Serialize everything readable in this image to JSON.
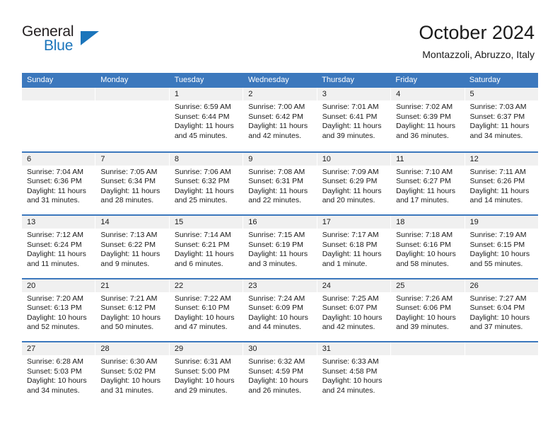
{
  "brand": {
    "name_part1": "General",
    "name_part2": "Blue",
    "logo_icon": "triangle-logo-icon"
  },
  "header": {
    "title": "October 2024",
    "subtitle": "Montazzoli, Abruzzo, Italy"
  },
  "colors": {
    "header_blue": "#3c78bd",
    "brand_blue": "#1b75bb",
    "daynum_bg": "#f0f0f0",
    "text": "#1a1a1a"
  },
  "weekdays": [
    "Sunday",
    "Monday",
    "Tuesday",
    "Wednesday",
    "Thursday",
    "Friday",
    "Saturday"
  ],
  "labels": {
    "sunrise_prefix": "Sunrise: ",
    "sunset_prefix": "Sunset: ",
    "daylight_prefix": "Daylight: "
  },
  "weeks": [
    [
      {
        "day": "",
        "empty": true
      },
      {
        "day": "",
        "empty": true
      },
      {
        "day": "1",
        "sunrise": "Sunrise: 6:59 AM",
        "sunset": "Sunset: 6:44 PM",
        "daylight": "Daylight: 11 hours and 45 minutes."
      },
      {
        "day": "2",
        "sunrise": "Sunrise: 7:00 AM",
        "sunset": "Sunset: 6:42 PM",
        "daylight": "Daylight: 11 hours and 42 minutes."
      },
      {
        "day": "3",
        "sunrise": "Sunrise: 7:01 AM",
        "sunset": "Sunset: 6:41 PM",
        "daylight": "Daylight: 11 hours and 39 minutes."
      },
      {
        "day": "4",
        "sunrise": "Sunrise: 7:02 AM",
        "sunset": "Sunset: 6:39 PM",
        "daylight": "Daylight: 11 hours and 36 minutes."
      },
      {
        "day": "5",
        "sunrise": "Sunrise: 7:03 AM",
        "sunset": "Sunset: 6:37 PM",
        "daylight": "Daylight: 11 hours and 34 minutes."
      }
    ],
    [
      {
        "day": "6",
        "sunrise": "Sunrise: 7:04 AM",
        "sunset": "Sunset: 6:36 PM",
        "daylight": "Daylight: 11 hours and 31 minutes."
      },
      {
        "day": "7",
        "sunrise": "Sunrise: 7:05 AM",
        "sunset": "Sunset: 6:34 PM",
        "daylight": "Daylight: 11 hours and 28 minutes."
      },
      {
        "day": "8",
        "sunrise": "Sunrise: 7:06 AM",
        "sunset": "Sunset: 6:32 PM",
        "daylight": "Daylight: 11 hours and 25 minutes."
      },
      {
        "day": "9",
        "sunrise": "Sunrise: 7:08 AM",
        "sunset": "Sunset: 6:31 PM",
        "daylight": "Daylight: 11 hours and 22 minutes."
      },
      {
        "day": "10",
        "sunrise": "Sunrise: 7:09 AM",
        "sunset": "Sunset: 6:29 PM",
        "daylight": "Daylight: 11 hours and 20 minutes."
      },
      {
        "day": "11",
        "sunrise": "Sunrise: 7:10 AM",
        "sunset": "Sunset: 6:27 PM",
        "daylight": "Daylight: 11 hours and 17 minutes."
      },
      {
        "day": "12",
        "sunrise": "Sunrise: 7:11 AM",
        "sunset": "Sunset: 6:26 PM",
        "daylight": "Daylight: 11 hours and 14 minutes."
      }
    ],
    [
      {
        "day": "13",
        "sunrise": "Sunrise: 7:12 AM",
        "sunset": "Sunset: 6:24 PM",
        "daylight": "Daylight: 11 hours and 11 minutes."
      },
      {
        "day": "14",
        "sunrise": "Sunrise: 7:13 AM",
        "sunset": "Sunset: 6:22 PM",
        "daylight": "Daylight: 11 hours and 9 minutes."
      },
      {
        "day": "15",
        "sunrise": "Sunrise: 7:14 AM",
        "sunset": "Sunset: 6:21 PM",
        "daylight": "Daylight: 11 hours and 6 minutes."
      },
      {
        "day": "16",
        "sunrise": "Sunrise: 7:15 AM",
        "sunset": "Sunset: 6:19 PM",
        "daylight": "Daylight: 11 hours and 3 minutes."
      },
      {
        "day": "17",
        "sunrise": "Sunrise: 7:17 AM",
        "sunset": "Sunset: 6:18 PM",
        "daylight": "Daylight: 11 hours and 1 minute."
      },
      {
        "day": "18",
        "sunrise": "Sunrise: 7:18 AM",
        "sunset": "Sunset: 6:16 PM",
        "daylight": "Daylight: 10 hours and 58 minutes."
      },
      {
        "day": "19",
        "sunrise": "Sunrise: 7:19 AM",
        "sunset": "Sunset: 6:15 PM",
        "daylight": "Daylight: 10 hours and 55 minutes."
      }
    ],
    [
      {
        "day": "20",
        "sunrise": "Sunrise: 7:20 AM",
        "sunset": "Sunset: 6:13 PM",
        "daylight": "Daylight: 10 hours and 52 minutes."
      },
      {
        "day": "21",
        "sunrise": "Sunrise: 7:21 AM",
        "sunset": "Sunset: 6:12 PM",
        "daylight": "Daylight: 10 hours and 50 minutes."
      },
      {
        "day": "22",
        "sunrise": "Sunrise: 7:22 AM",
        "sunset": "Sunset: 6:10 PM",
        "daylight": "Daylight: 10 hours and 47 minutes."
      },
      {
        "day": "23",
        "sunrise": "Sunrise: 7:24 AM",
        "sunset": "Sunset: 6:09 PM",
        "daylight": "Daylight: 10 hours and 44 minutes."
      },
      {
        "day": "24",
        "sunrise": "Sunrise: 7:25 AM",
        "sunset": "Sunset: 6:07 PM",
        "daylight": "Daylight: 10 hours and 42 minutes."
      },
      {
        "day": "25",
        "sunrise": "Sunrise: 7:26 AM",
        "sunset": "Sunset: 6:06 PM",
        "daylight": "Daylight: 10 hours and 39 minutes."
      },
      {
        "day": "26",
        "sunrise": "Sunrise: 7:27 AM",
        "sunset": "Sunset: 6:04 PM",
        "daylight": "Daylight: 10 hours and 37 minutes."
      }
    ],
    [
      {
        "day": "27",
        "sunrise": "Sunrise: 6:28 AM",
        "sunset": "Sunset: 5:03 PM",
        "daylight": "Daylight: 10 hours and 34 minutes."
      },
      {
        "day": "28",
        "sunrise": "Sunrise: 6:30 AM",
        "sunset": "Sunset: 5:02 PM",
        "daylight": "Daylight: 10 hours and 31 minutes."
      },
      {
        "day": "29",
        "sunrise": "Sunrise: 6:31 AM",
        "sunset": "Sunset: 5:00 PM",
        "daylight": "Daylight: 10 hours and 29 minutes."
      },
      {
        "day": "30",
        "sunrise": "Sunrise: 6:32 AM",
        "sunset": "Sunset: 4:59 PM",
        "daylight": "Daylight: 10 hours and 26 minutes."
      },
      {
        "day": "31",
        "sunrise": "Sunrise: 6:33 AM",
        "sunset": "Sunset: 4:58 PM",
        "daylight": "Daylight: 10 hours and 24 minutes."
      },
      {
        "day": "",
        "empty": true
      },
      {
        "day": "",
        "empty": true
      }
    ]
  ]
}
